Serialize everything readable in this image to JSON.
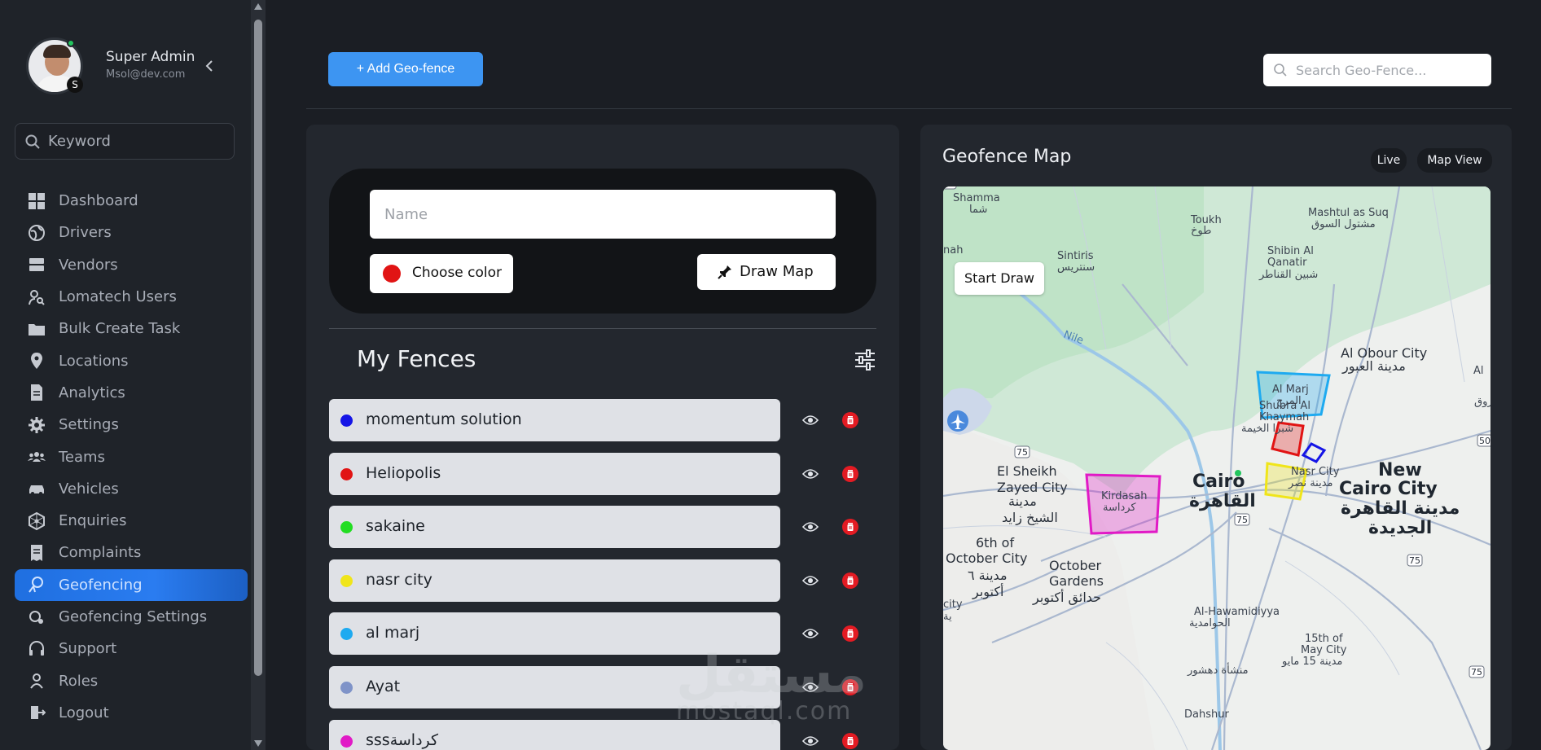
{
  "profile": {
    "name": "Super Admin",
    "email": "Msol@dev.com",
    "badge": "S"
  },
  "sidebar_search": {
    "placeholder": "Keyword"
  },
  "nav": [
    {
      "label": "Dashboard",
      "icon": "dashboard-icon"
    },
    {
      "label": "Drivers",
      "icon": "globe-icon"
    },
    {
      "label": "Vendors",
      "icon": "server-icon"
    },
    {
      "label": "Lomatech Users",
      "icon": "user-search-icon"
    },
    {
      "label": "Bulk Create Task",
      "icon": "folder-icon"
    },
    {
      "label": "Locations",
      "icon": "location-pin-icon"
    },
    {
      "label": "Analytics",
      "icon": "document-icon"
    },
    {
      "label": "Settings",
      "icon": "gear-icon"
    },
    {
      "label": "Teams",
      "icon": "team-icon"
    },
    {
      "label": "Vehicles",
      "icon": "car-icon"
    },
    {
      "label": "Enquiries",
      "icon": "network-icon"
    },
    {
      "label": "Complaints",
      "icon": "receipt-icon"
    },
    {
      "label": "Geofencing",
      "icon": "geofence-icon",
      "active": true
    },
    {
      "label": "Geofencing Settings",
      "icon": "geofence-settings-icon"
    },
    {
      "label": "Support",
      "icon": "headset-icon"
    },
    {
      "label": "Roles",
      "icon": "user-icon"
    },
    {
      "label": "Logout",
      "icon": "logout-icon"
    }
  ],
  "toolbar": {
    "add_label": "+ Add Geo-fence",
    "search_placeholder": "Search Geo-Fence..."
  },
  "form": {
    "name_placeholder": "Name",
    "choose_color_label": "Choose color",
    "selected_color": "#e11414",
    "draw_map_label": "Draw Map"
  },
  "fences": {
    "title": "My Fences",
    "items": [
      {
        "name": "momentum solution",
        "color": "#1515e6"
      },
      {
        "name": "Heliopolis",
        "color": "#e11414"
      },
      {
        "name": "sakaine",
        "color": "#22dd22"
      },
      {
        "name": "nasr city",
        "color": "#f0e51a"
      },
      {
        "name": "al marj",
        "color": "#1eaaf0"
      },
      {
        "name": "Ayat",
        "color": "#7f93c8"
      },
      {
        "name": "sssكرداسة",
        "color": "#e11ac6"
      }
    ]
  },
  "map": {
    "title": "Geofence Map",
    "live_label": "Live",
    "mapview_label": "Map View",
    "start_draw_label": "Start Draw",
    "labels": [
      {
        "text": "Shamma",
        "style": "small"
      },
      {
        "text": "شما",
        "style": "small"
      },
      {
        "text": "Toukh",
        "style": "small"
      },
      {
        "text": "طوخ",
        "style": "small"
      },
      {
        "text": "Mashtul as Suq",
        "style": "small"
      },
      {
        "text": "مشتول السوق",
        "style": "small"
      },
      {
        "text": "Sintiris",
        "style": "small"
      },
      {
        "text": "سنتريس",
        "style": "small"
      },
      {
        "text": "Shibin Al",
        "style": "small"
      },
      {
        "text": "Qanatir",
        "style": "small"
      },
      {
        "text": "شبين القناطر",
        "style": "small"
      },
      {
        "text": "nah",
        "style": "small"
      },
      {
        "text": "Nile",
        "style": "water"
      },
      {
        "text": "Al Obour City",
        "style": "medium"
      },
      {
        "text": "مدينة العبور",
        "style": "medium"
      },
      {
        "text": "Al",
        "style": "small"
      },
      {
        "text": "روق",
        "style": "small"
      },
      {
        "text": "Shubra Al",
        "style": "small"
      },
      {
        "text": "Khaymah",
        "style": "small"
      },
      {
        "text": "شبرا الخيمة",
        "style": "small"
      },
      {
        "text": "Al Marj",
        "style": "small"
      },
      {
        "text": "المرج",
        "style": "small"
      },
      {
        "text": "El Sheikh",
        "style": "medium"
      },
      {
        "text": "Zayed City",
        "style": "medium"
      },
      {
        "text": "مدينة",
        "style": "medium"
      },
      {
        "text": "الشيخ زايد",
        "style": "medium"
      },
      {
        "text": "Kirdasah",
        "style": "small"
      },
      {
        "text": "كرداسة",
        "style": "small"
      },
      {
        "text": "Cairo",
        "style": "large"
      },
      {
        "text": "القاهرة",
        "style": "large"
      },
      {
        "text": "Nasr City",
        "style": "small"
      },
      {
        "text": "مدينة نصر",
        "style": "small"
      },
      {
        "text": "New",
        "style": "large"
      },
      {
        "text": "Cairo City",
        "style": "large"
      },
      {
        "text": "مدينة القاهرة",
        "style": "large"
      },
      {
        "text": "الجديدة",
        "style": "large"
      },
      {
        "text": "6th of",
        "style": "medium"
      },
      {
        "text": "October City",
        "style": "medium"
      },
      {
        "text": "مدينة ٦",
        "style": "medium"
      },
      {
        "text": "أكتوبر",
        "style": "medium"
      },
      {
        "text": "October",
        "style": "medium"
      },
      {
        "text": "Gardens",
        "style": "medium"
      },
      {
        "text": "حدائق أكتوبر",
        "style": "medium"
      },
      {
        "text": "Al-Hawamidiyya",
        "style": "small"
      },
      {
        "text": "الحوامدية",
        "style": "small"
      },
      {
        "text": "15th of",
        "style": "small"
      },
      {
        "text": "May City",
        "style": "small"
      },
      {
        "text": "مدينة 15 مايو",
        "style": "small"
      },
      {
        "text": "منشأة دهشور",
        "style": "small"
      },
      {
        "text": "Dahshur",
        "style": "small"
      },
      {
        "text": "city",
        "style": "small"
      },
      {
        "text": "ية",
        "style": "small"
      },
      {
        "text": "50",
        "style": "shield"
      },
      {
        "text": "75",
        "style": "shield"
      },
      {
        "text": "75",
        "style": "shield"
      },
      {
        "text": "75",
        "style": "shield"
      },
      {
        "text": "75",
        "style": "shield"
      },
      {
        "text": "75",
        "style": "shield"
      }
    ]
  },
  "watermark": {
    "line1": "مستقل",
    "line2": "mostaql.com"
  }
}
